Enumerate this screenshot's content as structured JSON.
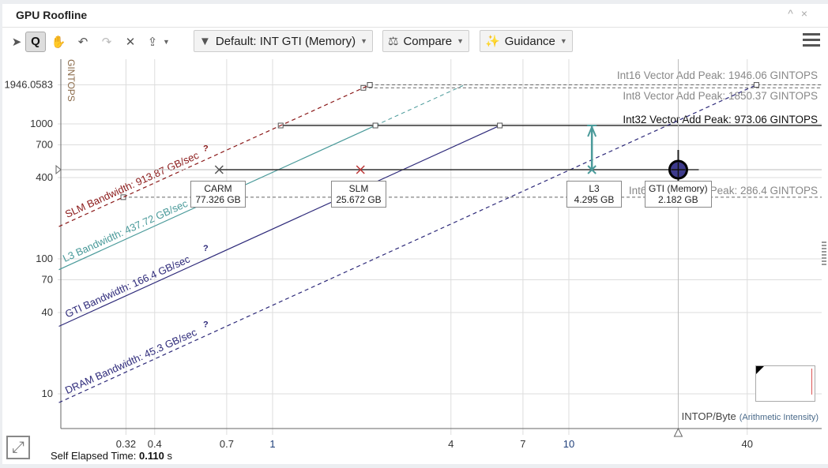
{
  "window": {
    "title": "GPU Roofline",
    "controls": [
      "^",
      "×"
    ]
  },
  "toolbar": {
    "tools": [
      "pointer-icon",
      "zoom-icon",
      "pan-icon",
      "undo-icon",
      "redo-icon",
      "clear-icon",
      "export-icon"
    ],
    "filter_label": "Default: INT GTI (Memory)",
    "compare_label": "Compare",
    "guidance_label": "Guidance"
  },
  "footer": {
    "elapsed_label": "Self Elapsed Time:",
    "elapsed_value": "0.110",
    "elapsed_unit": "s"
  },
  "colors": {
    "slm": "#8b1a1a",
    "l3": "#4a9a9a",
    "gti": "#2e2a7a",
    "dram": "#2e2a7a",
    "point": "#3d3a8c"
  },
  "chart_data": {
    "type": "scatter",
    "xscale": "log",
    "yscale": "log",
    "ylabel": "GINTOPS",
    "xlabel": "INTOP/Byte",
    "xlabel_sub": "(Arithmetic Intensity)",
    "xlim": [
      0.19,
      55
    ],
    "ylim": [
      5.5,
      3000
    ],
    "xticks": [
      "0.32",
      "0.4",
      "0.7",
      "1",
      "4",
      "7",
      "10",
      "40"
    ],
    "yticks": [
      "1946.0583",
      "1000",
      "700",
      "400",
      "100",
      "70",
      "40",
      "10"
    ],
    "compute_roofs": [
      {
        "name": "Int16 Vector Add Peak: 1946.06 GINTOPS",
        "value": 1946.06,
        "style": "dashed"
      },
      {
        "name": "Int8 Vector Add Peak: 1850.37 GINTOPS",
        "value": 1850.37,
        "style": "dashed"
      },
      {
        "name": "Int32 Vector Add Peak: 973.06 GINTOPS",
        "value": 973.06,
        "style": "solid"
      },
      {
        "name": "Int64 Vector Add Peak: 286.4 GINTOPS",
        "value": 286.4,
        "style": "dashed"
      }
    ],
    "memory_roofs": [
      {
        "name": "SLM Bandwidth: 913.87 GB/sec",
        "value": 913.87,
        "color": "#8b1a1a",
        "style": "dashed"
      },
      {
        "name": "L3 Bandwidth: 437.72 GB/sec",
        "value": 437.72,
        "color": "#4a9a9a",
        "style": "solid"
      },
      {
        "name": "GTI Bandwidth: 166.4 GB/sec",
        "value": 166.4,
        "color": "#2e2a7a",
        "style": "solid"
      },
      {
        "name": "DRAM Bandwidth: 45.3 GB/sec",
        "value": 45.3,
        "color": "#2e2a7a",
        "style": "dashed"
      }
    ],
    "points": [
      {
        "name": "CARM",
        "traffic": "77.326 GB",
        "x": 0.66,
        "y": 458
      },
      {
        "name": "SLM",
        "traffic": "25.672 GB",
        "x": 1.98,
        "y": 458
      },
      {
        "name": "L3",
        "traffic": "4.295 GB",
        "x": 11.96,
        "y": 458
      },
      {
        "name": "GTI (Memory)",
        "traffic": "2.182 GB",
        "x": 23.4,
        "y": 458
      }
    ]
  }
}
